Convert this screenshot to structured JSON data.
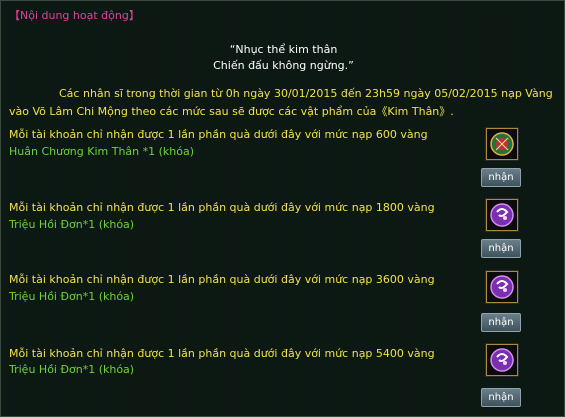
{
  "header": {
    "title": "【Nội dung hoạt động】"
  },
  "quote": {
    "line1": "“Nhục thể kim thân",
    "line2": "Chiến đấu không ngừng.”"
  },
  "intro": {
    "text": "Các nhân sĩ trong thời gian từ 0h ngày 30/01/2015 đến 23h59 ngày 05/02/2015 nạp Vàng vào Võ Lâm Chi Mộng theo các mức sau sẽ được các vật phẩm của《Kim Thân》."
  },
  "rewards": [
    {
      "requirement": "Mỗi tài khoản chỉ nhận được 1 lần phần quà dưới đây với mức nạp 600 vàng",
      "item": "Huân Chương Kim Thân *1 (khóa)",
      "icon": "medal-icon",
      "button": "nhận"
    },
    {
      "requirement": "Mỗi tài khoản chỉ nhận được 1 lần phần quà dưới đây với mức nạp 1800 vàng",
      "item": "Triệu Hồi Đơn*1 (khóa)",
      "icon": "summon-orb-icon",
      "button": "nhận"
    },
    {
      "requirement": "Mỗi tài khoản chỉ nhận được 1 lần phần quà dưới đây với mức nạp 3600 vàng",
      "item": "Triệu Hồi Đơn*1 (khóa)",
      "icon": "summon-orb-icon",
      "button": "nhận"
    },
    {
      "requirement": "Mỗi tài khoản chỉ nhận được 1 lần phần quà dưới đây với mức nạp 5400 vàng",
      "item": "Triệu Hồi Đơn*1 (khóa)",
      "icon": "summon-orb-icon",
      "button": "nhận"
    }
  ],
  "colors": {
    "title": "#e0409a",
    "requirement": "#f0e24a",
    "reward": "#6fd13a",
    "quote": "#ffffff"
  }
}
